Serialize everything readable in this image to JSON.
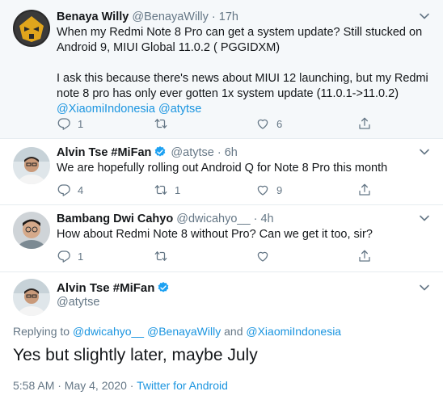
{
  "tweets": [
    {
      "name": "Benaya Willy",
      "handle": "@BenayaWilly",
      "sep": "·",
      "time": "17h",
      "text_line1": "When my Redmi Note 8 Pro can get a system update? Still stucked on",
      "text_line2": "Android 9, MIUI Global 11.0.2 ( PGGIDXM)",
      "text_line3": "I ask this because there's news about MIUI 12 launching, but my Redmi",
      "text_line4": "note 8 pro has only ever gotten 1x system update (11.0.1->11.0.2)",
      "mention1": "@XiaomiIndonesia",
      "mention2": "@atytse",
      "reply_count": "1",
      "retweet_count": "",
      "like_count": "6"
    },
    {
      "name": "Alvin Tse #MiFan",
      "handle": "@atytse",
      "sep": "·",
      "time": "6h",
      "text": "We are hopefully rolling out Android Q for Note 8 Pro this month",
      "reply_count": "4",
      "retweet_count": "1",
      "like_count": "9"
    },
    {
      "name": "Bambang Dwi Cahyo",
      "handle": "@dwicahyo__",
      "sep": "·",
      "time": "4h",
      "text": "How about Redmi Note 8 without Pro? Can we get it too, sir?",
      "reply_count": "1",
      "retweet_count": "",
      "like_count": ""
    }
  ],
  "main_tweet": {
    "name": "Alvin Tse #MiFan",
    "handle": "@atytse",
    "replying_prefix": "Replying to",
    "replying_1": "@dwicahyo__",
    "replying_2": "@BenayaWilly",
    "replying_and": "and",
    "replying_3": "@XiaomiIndonesia",
    "text": "Yes but slightly later, maybe July",
    "time": "5:58 AM · May 4, 2020",
    "meta_sep": "·",
    "source": "Twitter for Android"
  },
  "colors": {
    "link": "#1b95e0",
    "muted": "#657786",
    "verified": "#1da1f2",
    "highlight_bg": "#f5f8fa"
  },
  "icons": [
    "reply-icon",
    "retweet-icon",
    "like-icon",
    "share-icon",
    "chevron-down-icon",
    "verified-badge-icon"
  ]
}
